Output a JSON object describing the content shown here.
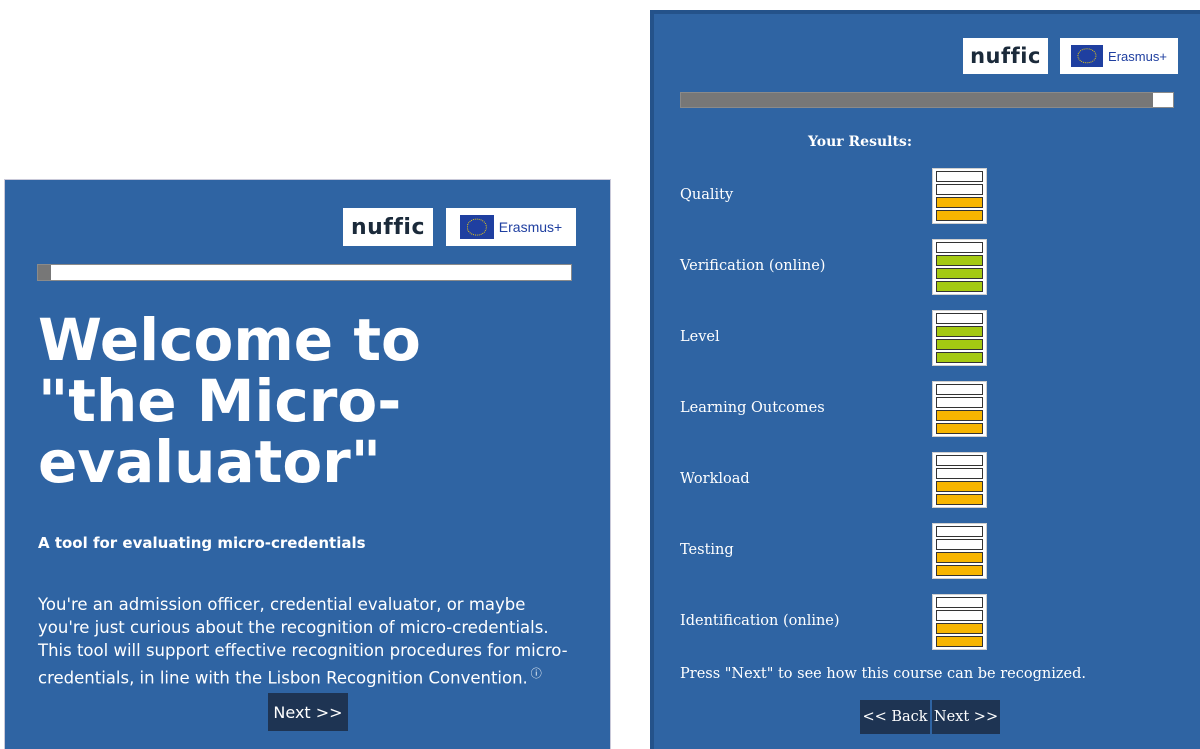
{
  "colors": {
    "panel_bg": "#2f64a3",
    "button_bg": "#1e3453",
    "progress_fill": "#777777",
    "rating_orange": "#f7b500",
    "rating_green": "#a4c912",
    "rating_empty": "#ffffff"
  },
  "logos": {
    "nuffic": "nuffic",
    "erasmus": "Erasmus+"
  },
  "welcome": {
    "progress": 0.025,
    "title": "Welcome to\n\"the Micro-\nevaluator\"",
    "subtitle": "A tool for evaluating micro-credentials",
    "intro": "You're an admission officer, credential evaluator, or maybe you're just curious about the recognition of micro-credentials. This tool will support effective recognition procedures for micro-credentials, in line with the Lisbon Recognition Convention.",
    "info_icon": "ⓘ",
    "next_label": "Next >>"
  },
  "results": {
    "progress": 0.96,
    "heading": "Your Results:",
    "items": [
      {
        "label": "Quality",
        "filled": 2,
        "total": 4,
        "color": "orange"
      },
      {
        "label": "Verification (online)",
        "filled": 3,
        "total": 4,
        "color": "green"
      },
      {
        "label": "Level",
        "filled": 3,
        "total": 4,
        "color": "green"
      },
      {
        "label": "Learning Outcomes",
        "filled": 2,
        "total": 4,
        "color": "orange"
      },
      {
        "label": "Workload",
        "filled": 2,
        "total": 4,
        "color": "orange"
      },
      {
        "label": "Testing",
        "filled": 2,
        "total": 4,
        "color": "orange"
      },
      {
        "label": "Identification (online)",
        "filled": 2,
        "total": 4,
        "color": "orange"
      }
    ],
    "footer": "Press \"Next\" to see how this course can be recognized.",
    "back_label": "<< Back",
    "next_label": "Next >>"
  }
}
